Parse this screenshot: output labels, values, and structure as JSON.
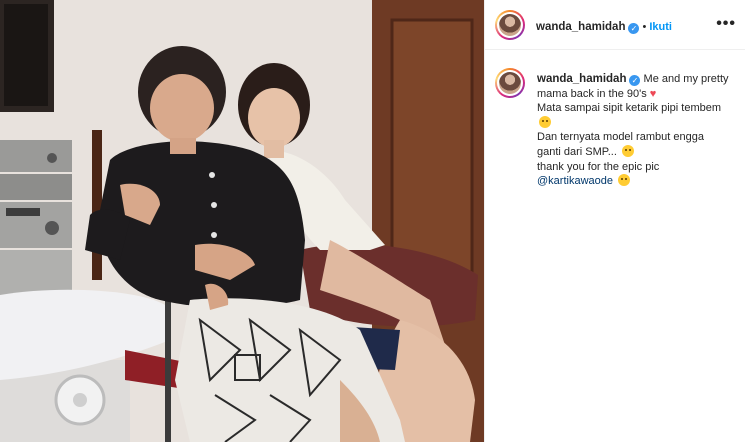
{
  "post": {
    "username": "wanda_hamidah",
    "verified": true,
    "separator": "•",
    "follow_label": "Ikuti",
    "more_icon": "more-options-icon",
    "more_glyph": "•••"
  },
  "caption": {
    "username": "wanda_hamidah",
    "line1_text": "Me and my pretty",
    "line2_text": "mama back in the 90's",
    "line3_text": "Mata sampai sipit ketarik pipi tembem",
    "line5_text": "Dan ternyata model rambut engga",
    "line6_text": "ganti dari SMP...",
    "line7_text": "thank you for the epic pic",
    "mention": "@kartikawaode",
    "emojis": [
      "red-heart-emoji",
      "laughing-emoji",
      "grinning-emoji",
      "kissing-emoji"
    ]
  },
  "colors": {
    "accent_blue": "#0095f6",
    "verified_blue": "#3897f0",
    "heart_red": "#ed4956",
    "mention": "#00376b"
  }
}
